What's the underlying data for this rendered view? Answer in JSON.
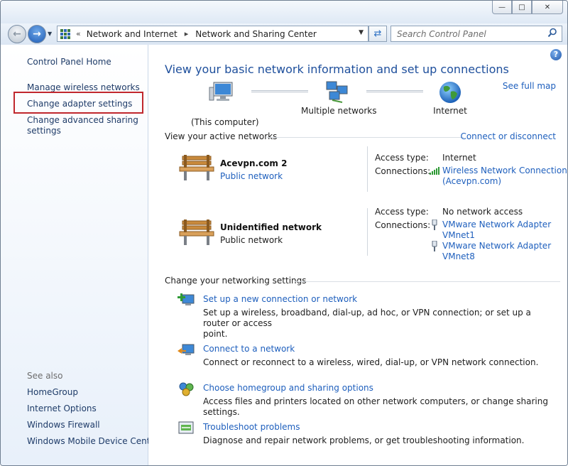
{
  "window": {
    "controls": {
      "minimize": "—",
      "maximize": "□",
      "close": "✕"
    }
  },
  "nav": {
    "back_icon": "back-arrow-icon",
    "forward_icon": "forward-arrow-icon",
    "breadcrumb": [
      "Network and Internet",
      "Network and Sharing Center"
    ],
    "breadcrumb_overflow": "«",
    "separator": "▸",
    "search_placeholder": "Search Control Panel"
  },
  "sidebar": {
    "home": "Control Panel Home",
    "items": [
      {
        "label": "Manage wireless networks"
      },
      {
        "label": "Change adapter settings",
        "highlighted": true
      },
      {
        "label": "Change advanced sharing settings",
        "line1": "Change advanced sharing",
        "line2": "settings"
      }
    ],
    "see_also_label": "See also",
    "see_also": [
      "HomeGroup",
      "Internet Options",
      "Windows Firewall",
      "Windows Mobile Device Center"
    ],
    "highlight_color": "#c0272d"
  },
  "main": {
    "title": "View your basic network information and set up connections",
    "see_full_map": "See full map",
    "map": {
      "computer": "(This computer)",
      "networks": "Multiple networks",
      "internet": "Internet"
    },
    "active_networks_heading": "View your active networks",
    "connect_disconnect": "Connect or disconnect",
    "networks": [
      {
        "name": "Acevpn.com  2",
        "category": "Public network",
        "category_is_link": true,
        "access_type_label": "Access type:",
        "access_type": "Internet",
        "connections_label": "Connections:",
        "connections": [
          {
            "line1": "Wireless Network Connection",
            "line2": "(Acevpn.com)",
            "icon": "wifi-signal-icon"
          }
        ]
      },
      {
        "name": "Unidentified network",
        "category": "Public network",
        "category_is_link": false,
        "access_type_label": "Access type:",
        "access_type": "No network access",
        "connections_label": "Connections:",
        "connections": [
          {
            "line1": "VMware Network Adapter",
            "line2": "VMnet1",
            "icon": "ethernet-plug-icon"
          },
          {
            "line1": "VMware Network Adapter",
            "line2": "VMnet8",
            "icon": "ethernet-plug-icon"
          }
        ]
      }
    ],
    "change_settings_heading": "Change your networking settings",
    "tasks": [
      {
        "link": "Set up a new connection or network",
        "desc_line1": "Set up a wireless, broadband, dial-up, ad hoc, or VPN connection; or set up a router or access",
        "desc_line2": "point.",
        "icon": "new-connection-icon"
      },
      {
        "link": "Connect to a network",
        "desc_line1": "Connect or reconnect to a wireless, wired, dial-up, or VPN network connection.",
        "desc_line2": "",
        "icon": "connect-network-icon"
      },
      {
        "link": "Choose homegroup and sharing options",
        "desc_line1": "Access files and printers located on other network computers, or change sharing settings.",
        "desc_line2": "",
        "icon": "homegroup-icon"
      },
      {
        "link": "Troubleshoot problems",
        "desc_line1": "Diagnose and repair network problems, or get troubleshooting information.",
        "desc_line2": "",
        "icon": "troubleshoot-icon"
      }
    ]
  },
  "colors": {
    "link": "#1e5fbd",
    "title": "#1e4f9c",
    "sidebar_link": "#1e3b68"
  }
}
